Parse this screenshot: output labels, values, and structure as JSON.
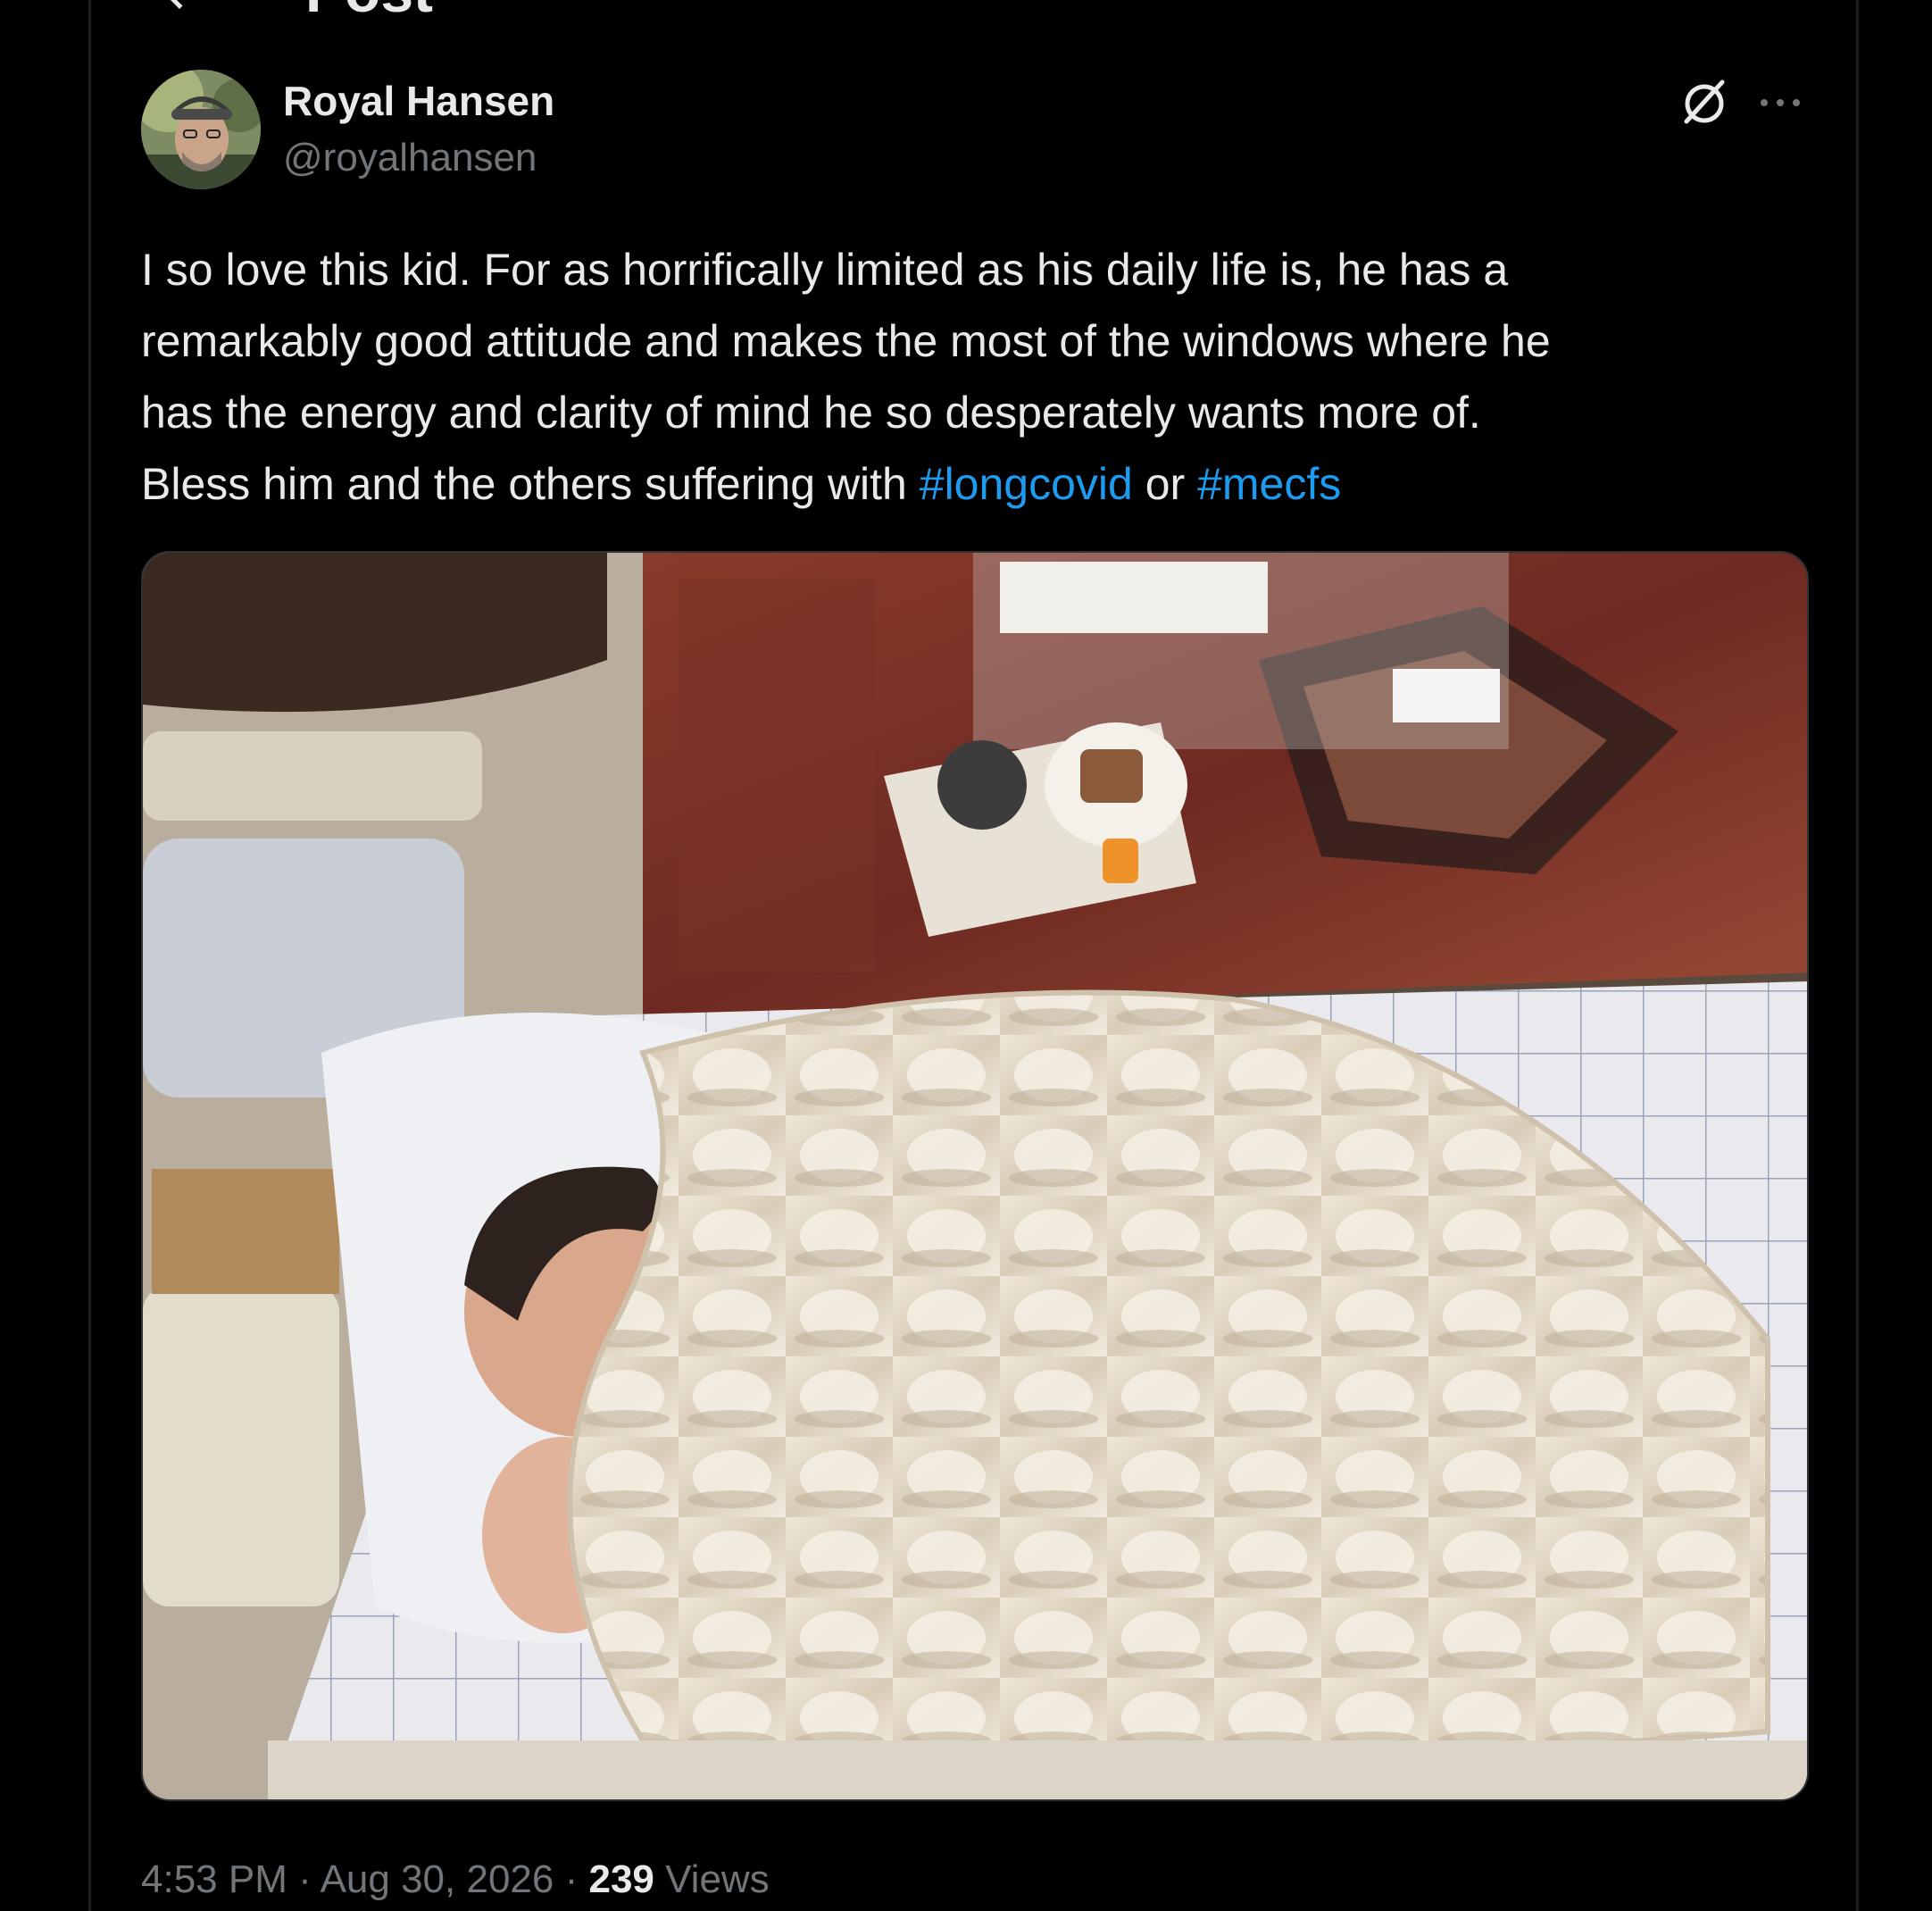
{
  "header": {
    "title": "Post"
  },
  "post": {
    "author": {
      "name": "Royal Hansen",
      "handle": "@royalhansen"
    },
    "text": {
      "line1": "I so love this kid. For as horrifically limited as his daily life is, he has a",
      "line2": "remarkably good attitude and makes the most of the windows where he",
      "line3": "has the energy and clarity of mind he so desperately wants more of.",
      "line4_prefix": "Bless him and the others suffering with ",
      "hashtag1": "#longcovid",
      "connector": " or ",
      "hashtag2": "#mecfs"
    },
    "meta": {
      "time": "4:53 PM",
      "separator": " · ",
      "date": "Aug 30, 2026",
      "views_count": "239",
      "views_label": " Views"
    }
  },
  "icons": {
    "back": "back-arrow-icon",
    "grok": "grok-icon",
    "more": "more-icon"
  },
  "colors": {
    "background": "#000000",
    "text_primary": "#e7e9ea",
    "text_secondary": "#71767b",
    "link": "#1d9bf0",
    "border": "#2f3336"
  }
}
